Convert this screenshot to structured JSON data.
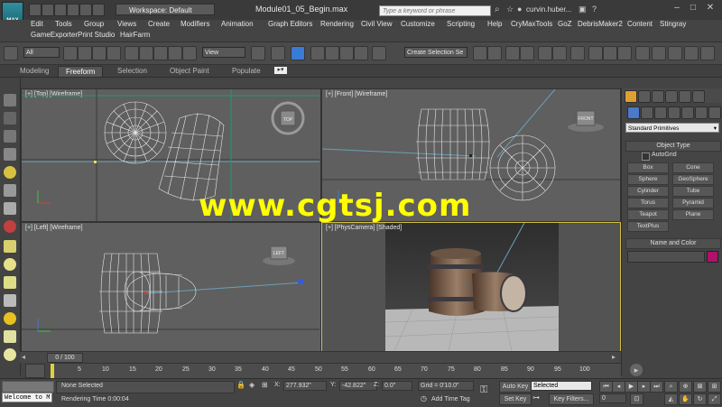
{
  "app": {
    "logo_text": "MAX",
    "workspace": "Workspace: Default",
    "window_title": "Module01_05_Begin.max",
    "search_placeholder": "Type a keyword or phrase",
    "user": "curvin.huber..."
  },
  "menus": [
    "Edit",
    "Tools",
    "Group",
    "Views",
    "Create",
    "Modifiers",
    "Animation",
    "Graph Editors",
    "Rendering",
    "Civil View",
    "Customize",
    "Scripting",
    "Help",
    "CryMaxTools",
    "GoZ",
    "DebrisMaker2",
    "Content",
    "Stingray"
  ],
  "menus2": [
    "GameExporter",
    "Print Studio",
    "HairFarm"
  ],
  "toolbar": {
    "selection_filter": "All",
    "ref_coord": "View",
    "named_selection": "Create Selection Se"
  },
  "ribbon_tabs": [
    "Modeling",
    "Freeform",
    "Selection",
    "Object Paint",
    "Populate"
  ],
  "ribbon_active": "Freeform",
  "viewports": {
    "top": "[+] [Top] [Wireframe]",
    "front": "[+] [Front] [Wireframe]",
    "left": "[+] [Left] [Wireframe]",
    "camera": "[+] [PhysCamera] [Shaded]"
  },
  "viewcube": {
    "top": "TOP",
    "front": "FRONT",
    "left": "LEFT"
  },
  "command_panel": {
    "category": "Standard Primitives",
    "object_type_header": "Object Type",
    "autogrid": "AutoGrid",
    "buttons": [
      "Box",
      "Cone",
      "Sphere",
      "GeoSphere",
      "Cylinder",
      "Tube",
      "Torus",
      "Pyramid",
      "Teapot",
      "Plane",
      "TextPlus"
    ],
    "name_color_header": "Name and Color",
    "color": "#b0126a"
  },
  "timeline": {
    "frame": "0 / 100",
    "ticks": [
      "5",
      "10",
      "15",
      "20",
      "25",
      "30",
      "35",
      "40",
      "45",
      "50",
      "55",
      "60",
      "65",
      "70",
      "75",
      "80",
      "85",
      "90",
      "95",
      "100"
    ]
  },
  "status": {
    "maxscript": "Welcome to M",
    "selection": "None Selected",
    "render_time": "Rendering Time  0:00:04",
    "x_label": "X:",
    "x": "277.932\"",
    "y_label": "Y:",
    "y": "-42.822\"",
    "z_label": "Z:",
    "z": "0.0\"",
    "grid": "Grid = 0'10.0\"",
    "add_time_tag": "Add Time Tag",
    "auto_key": "Auto Key",
    "set_key": "Set Key",
    "key_mode": "Selected",
    "key_filters": "Key Filters...",
    "frame_field": "0"
  },
  "watermark": "www.cgtsj.com"
}
